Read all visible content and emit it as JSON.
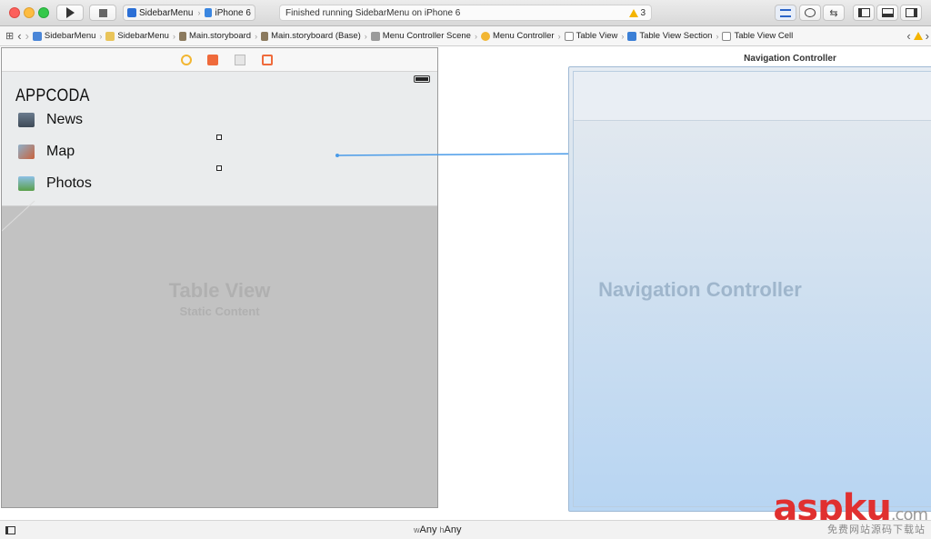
{
  "toolbar": {
    "scheme_name": "SidebarMenu",
    "device": "iPhone 6",
    "status_text": "Finished running SidebarMenu on iPhone 6",
    "warning_count": "3"
  },
  "breadcrumbs": [
    "SidebarMenu",
    "SidebarMenu",
    "Main.storyboard",
    "Main.storyboard (Base)",
    "Menu Controller Scene",
    "Menu Controller",
    "Table View",
    "Table View Section",
    "Table View Cell"
  ],
  "menu_scene": {
    "app_title": "APPCODA",
    "items": [
      {
        "label": "News",
        "icon": "news-icon"
      },
      {
        "label": "Map",
        "icon": "map-icon"
      },
      {
        "label": "Photos",
        "icon": "photos-icon"
      }
    ],
    "table_view_label": "Table View",
    "table_view_sublabel": "Static Content"
  },
  "nav_scene": {
    "title": "Navigation Controller",
    "placeholder": "Navigation Controller"
  },
  "bottombar": {
    "w_prefix": "w",
    "w_value": "Any",
    "h_prefix": "h",
    "h_value": "Any"
  },
  "watermark": {
    "brand": "aspku",
    "domain": ".com",
    "sub": "免费网站源码下载站"
  },
  "colors": {
    "segue_line": "#4a9be8",
    "watermark_red": "#e03030"
  }
}
